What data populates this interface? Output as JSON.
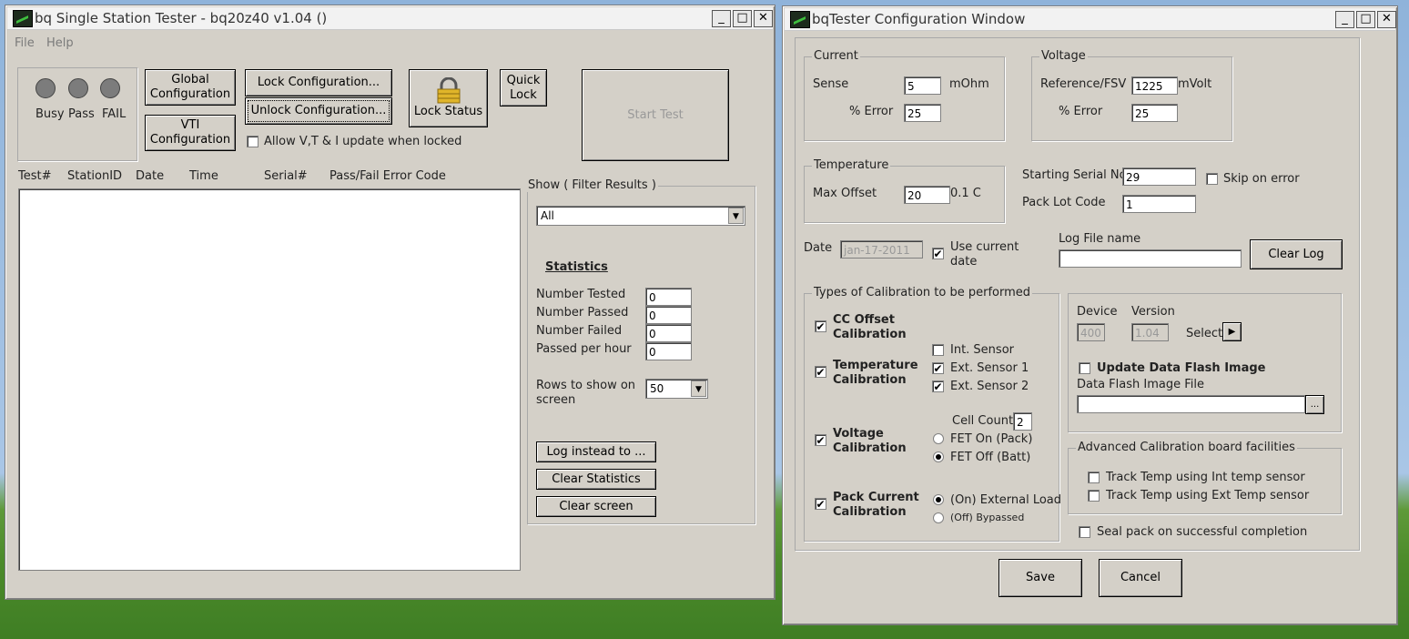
{
  "left_window": {
    "title": "bq Single Station Tester - bq20z40 v1.04 ()",
    "menu": {
      "file": "File",
      "help": "Help"
    },
    "leds": {
      "busy": "Busy",
      "pass": "Pass",
      "fail": "FAIL"
    },
    "buttons": {
      "global_config_line1": "Global",
      "global_config_line2": "Configuration",
      "vti_config_line1": "VTI",
      "vti_config_line2": "Configuration",
      "lock_config": "Lock Configuration...",
      "unlock_config": "Unlock Configuration...",
      "lock_status": "Lock Status",
      "quick_lock_line1": "Quick",
      "quick_lock_line2": "Lock",
      "start_test": "Start Test",
      "log_instead": "Log instead to ...",
      "clear_statistics": "Clear Statistics",
      "clear_screen": "Clear screen"
    },
    "allow_update_label": "Allow V,T & I update when locked",
    "columns": [
      "Test#",
      "StationID",
      "Date",
      "Time",
      "Serial#",
      "Pass/Fail Error Code"
    ],
    "filter": {
      "label": "Show ( Filter Results )",
      "value": "All"
    },
    "statistics": {
      "heading": "Statistics",
      "rows": [
        {
          "label": "Number Tested",
          "value": "0"
        },
        {
          "label": "Number Passed",
          "value": "0"
        },
        {
          "label": "Number Failed",
          "value": "0"
        },
        {
          "label": "Passed per hour",
          "value": "0"
        }
      ]
    },
    "rows_to_show": {
      "label_line1": "Rows to show on",
      "label_line2": "screen",
      "value": "50"
    }
  },
  "right_window": {
    "title": "bqTester Configuration Window",
    "current": {
      "group": "Current",
      "sense_label": "Sense",
      "sense_value": "5",
      "sense_unit": "mOhm",
      "error_label": "% Error",
      "error_value": "25"
    },
    "voltage": {
      "group": "Voltage",
      "ref_label": "Reference/FSV",
      "ref_value": "1225",
      "ref_unit": "mVolt",
      "error_label": "% Error",
      "error_value": "25"
    },
    "temperature": {
      "group": "Temperature",
      "max_offset_label": "Max Offset",
      "max_offset_value": "20",
      "unit": "0.1 C"
    },
    "serial": {
      "starting_label": "Starting Serial No.",
      "starting_value": "29",
      "skip_label": "Skip on error",
      "pack_lot_label": "Pack Lot Code",
      "pack_lot_value": "1"
    },
    "date": {
      "label": "Date",
      "value": "jan-17-2011",
      "use_current_line1": "Use current",
      "use_current_line2": "date"
    },
    "log": {
      "label": "Log File name",
      "value": "",
      "clear_button": "Clear Log"
    },
    "calibration": {
      "group": "Types of Calibration to be performed",
      "cc_line1": "CC Offset",
      "cc_line2": "Calibration",
      "temp_line1": "Temperature",
      "temp_line2": "Calibration",
      "int_sensor": "Int. Sensor",
      "ext_sensor1": "Ext. Sensor 1",
      "ext_sensor2": "Ext. Sensor 2",
      "voltage_line1": "Voltage",
      "voltage_line2": "Calibration",
      "cell_count_label": "Cell Count",
      "cell_count_value": "2",
      "fet_on": "FET On (Pack)",
      "fet_off": "FET Off (Batt)",
      "pack_current_line1": "Pack Current",
      "pack_current_line2": "Calibration",
      "on_external_load": "(On) External Load",
      "off_bypassed": "(Off) Bypassed"
    },
    "device": {
      "device_label": "Device",
      "device_value": "400",
      "version_label": "Version",
      "version_value": "1.04",
      "select_label": "Select",
      "update_dfi_label": "Update Data Flash Image",
      "dfi_file_label": "Data Flash Image File",
      "dfi_file_value": "",
      "browse_button": "..."
    },
    "advanced": {
      "group": "Advanced Calibration board facilities",
      "track_int": "Track Temp using Int temp sensor",
      "track_ext": "Track Temp using Ext Temp sensor"
    },
    "seal_label": "Seal pack on successful completion",
    "save_button": "Save",
    "cancel_button": "Cancel"
  }
}
